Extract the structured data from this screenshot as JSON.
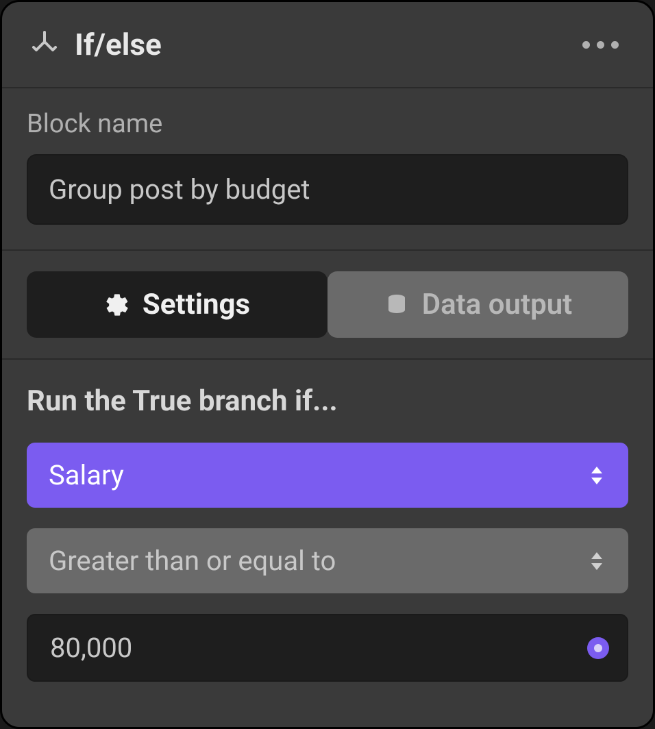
{
  "header": {
    "title": "If/else"
  },
  "block_name": {
    "label": "Block name",
    "value": "Group post by budget"
  },
  "tabs": {
    "settings": "Settings",
    "data_output": "Data output"
  },
  "condition": {
    "title": "Run the True branch if...",
    "field": "Salary",
    "operator": "Greater than or equal to",
    "value": "80,000"
  },
  "colors": {
    "accent": "#7b5cf0"
  }
}
